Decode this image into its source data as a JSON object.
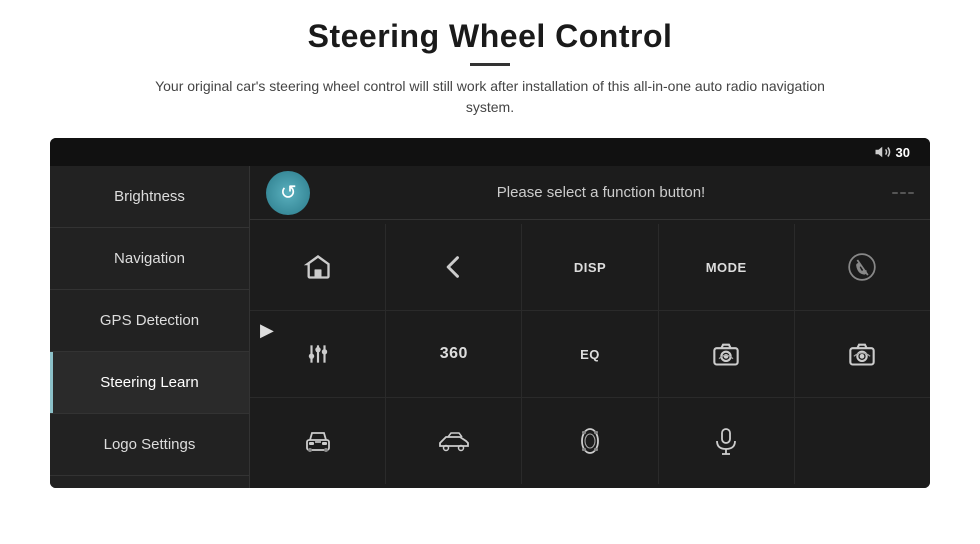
{
  "header": {
    "title": "Steering Wheel Control",
    "subtitle": "Your original car's steering wheel control will still work after installation of this all-in-one auto radio navigation system."
  },
  "topbar": {
    "volume_label": "30"
  },
  "sidebar": {
    "items": [
      {
        "id": "brightness",
        "label": "Brightness",
        "active": false
      },
      {
        "id": "navigation",
        "label": "Navigation",
        "active": false
      },
      {
        "id": "gps-detection",
        "label": "GPS Detection",
        "active": false
      },
      {
        "id": "steering-learn",
        "label": "Steering Learn",
        "active": true
      },
      {
        "id": "logo-settings",
        "label": "Logo Settings",
        "active": false
      }
    ]
  },
  "control": {
    "prompt": "Please select a function button!",
    "refresh_label": "↻"
  },
  "grid": {
    "rows": [
      [
        {
          "id": "home",
          "type": "icon",
          "icon": "home"
        },
        {
          "id": "back",
          "type": "icon",
          "icon": "back"
        },
        {
          "id": "disp",
          "type": "text",
          "label": "DISP"
        },
        {
          "id": "mode",
          "type": "text",
          "label": "MODE"
        },
        {
          "id": "phone-cancel",
          "type": "icon",
          "icon": "phone-cancel"
        }
      ],
      [
        {
          "id": "eq-adjust",
          "type": "icon",
          "icon": "sliders"
        },
        {
          "id": "360",
          "type": "text",
          "label": "360"
        },
        {
          "id": "eq",
          "type": "text",
          "label": "EQ"
        },
        {
          "id": "camera1",
          "type": "icon",
          "icon": "camera"
        },
        {
          "id": "camera2",
          "type": "icon",
          "icon": "camera2"
        }
      ],
      [
        {
          "id": "car1",
          "type": "icon",
          "icon": "car-front"
        },
        {
          "id": "car2",
          "type": "icon",
          "icon": "car-side"
        },
        {
          "id": "car3",
          "type": "icon",
          "icon": "car-top"
        },
        {
          "id": "mic",
          "type": "icon",
          "icon": "microphone"
        },
        {
          "id": "empty",
          "type": "empty",
          "label": ""
        }
      ]
    ]
  },
  "colors": {
    "accent": "#5ab0be",
    "active_border": "#8bc0c8",
    "sidebar_bg": "#222222",
    "panel_bg": "#1c1c1c"
  }
}
